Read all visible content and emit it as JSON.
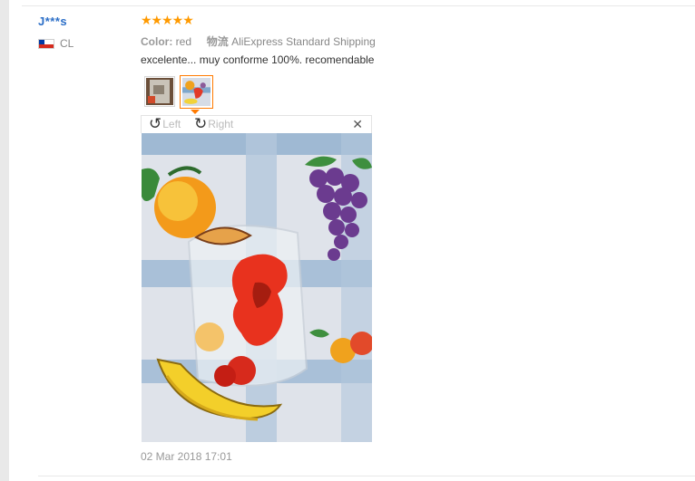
{
  "review": {
    "buyer_name": "J***s",
    "country": "CL",
    "stars": "★★★★★",
    "rating": 5,
    "color_label": "Color:",
    "color_value": "red",
    "shipping_label": "物流",
    "shipping_value": "AliExpress Standard Shipping",
    "feedback": "excelente... muy conforme 100%. recomendable",
    "date": "02 Mar 2018 17:01"
  },
  "viewer": {
    "rotate_left_label": "Left",
    "rotate_right_label": "Right",
    "close_symbol": "✕",
    "rotate_left_icon": "↺",
    "rotate_right_icon": "↻"
  },
  "colors": {
    "star": "#ff9a00",
    "name_link": "#2b6ec7",
    "selected_thumb": "#ff7a00"
  },
  "icons": [
    "chile-flag-icon",
    "rotate-left-icon",
    "rotate-right-icon",
    "close-icon",
    "star-icon"
  ]
}
